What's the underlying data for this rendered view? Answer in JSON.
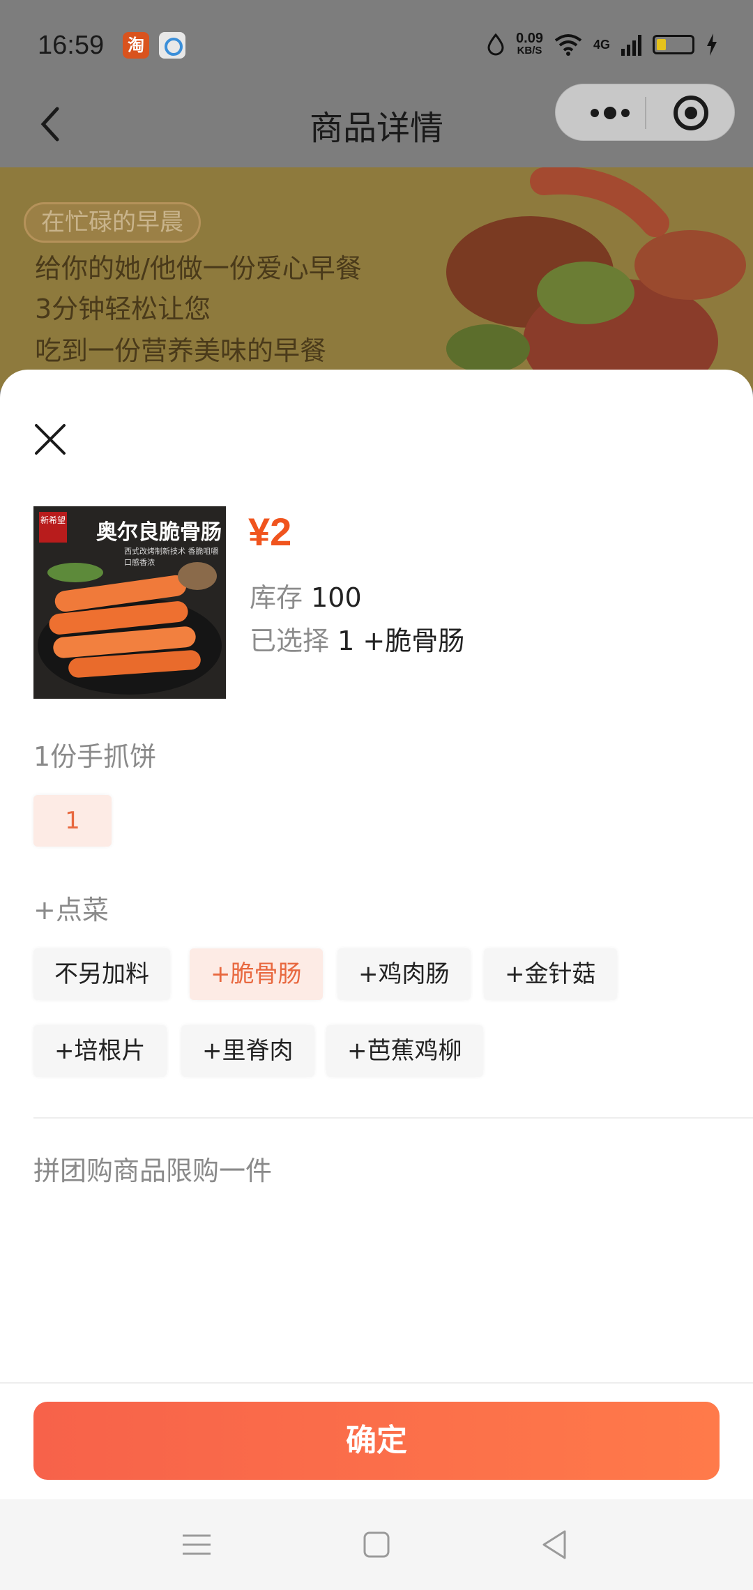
{
  "status_bar": {
    "time": "16:59",
    "app_icons": [
      "taobao-icon",
      "browser-icon"
    ],
    "taobao_badge": "淘",
    "net_speed_value": "0.09",
    "net_speed_unit": "KB/S",
    "network": "4G",
    "battery_level": 0.25
  },
  "nav": {
    "title": "商品详情",
    "back_icon": "chevron-left-icon",
    "more_icon": "more-dots-icon",
    "close_miniprogram_icon": "target-circle-icon"
  },
  "banner": {
    "tag": "在忙碌的早晨",
    "lines": [
      "给你的她/他做一份爱心早餐",
      "3分钟轻松让您",
      "吃到一份营养美味的早餐"
    ]
  },
  "sheet": {
    "close_icon": "close-icon",
    "product": {
      "image_title": "奥尔良脆骨肠",
      "image_subtitle": "西式改烤制新技术 香脆咀嚼 口感香浓",
      "brand_badge": "新希望",
      "price": "¥2",
      "stock_label": "库存",
      "stock_value": "100",
      "selected_label": "已选择",
      "selected_value": "1 +脆骨肠"
    },
    "groups": [
      {
        "title": "1份手抓饼",
        "options": [
          {
            "label": "1",
            "selected": true
          }
        ]
      },
      {
        "title": "+点菜",
        "options": [
          {
            "label": "不另加料",
            "selected": false
          },
          {
            "label": "+脆骨肠",
            "selected": true
          },
          {
            "label": "+鸡肉肠",
            "selected": false
          },
          {
            "label": "+金针菇",
            "selected": false
          },
          {
            "label": "+培根片",
            "selected": false
          },
          {
            "label": "+里脊肉",
            "selected": false
          },
          {
            "label": "+芭蕉鸡柳",
            "selected": false
          }
        ]
      }
    ],
    "limit_note": "拼团购商品限购一件",
    "confirm_label": "确定"
  },
  "system_nav": {
    "menu_icon": "menu-icon",
    "home_icon": "home-square-icon",
    "back_icon": "back-triangle-icon"
  },
  "colors": {
    "accent": "#f0541e",
    "chip_selected_bg": "#fdebe5",
    "chip_selected_text": "#e8683f",
    "button_gradient_start": "#f7624a",
    "button_gradient_end": "#ff7a4a"
  }
}
